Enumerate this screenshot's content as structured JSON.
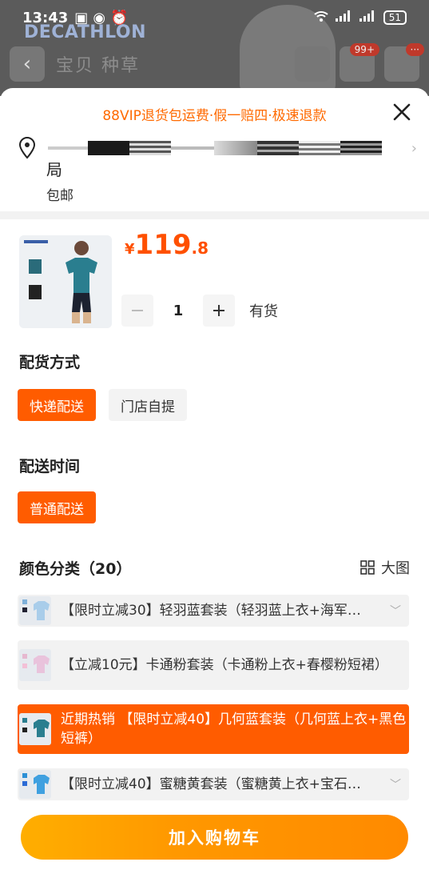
{
  "status_bar": {
    "time": "13:43",
    "battery": "51"
  },
  "background_page": {
    "brand": "DECATHLON",
    "tabs": "宝贝  种草",
    "cart_badge": "99+",
    "more_badge": "···"
  },
  "sheet": {
    "banner": "88VIP退货包运费·假一赔四·极速退款",
    "address_line2": "局",
    "shipping": "包邮",
    "price": {
      "currency": "¥",
      "integer": "119",
      "decimal": ".8"
    },
    "quantity": {
      "value": "1",
      "stock": "有货"
    },
    "delivery_method": {
      "title": "配货方式",
      "options": [
        {
          "label": "快递配送",
          "selected": true
        },
        {
          "label": "门店自提",
          "selected": false
        }
      ]
    },
    "delivery_time": {
      "title": "配送时间",
      "options": [
        {
          "label": "普通配送",
          "selected": true
        }
      ]
    },
    "colors": {
      "title": "颜色分类（20）",
      "big_image_label": "大图",
      "items": [
        {
          "label": "【限时立减30】轻羽蓝套装（轻羽蓝上衣+海军…",
          "selected": false
        },
        {
          "label": "【立减10元】卡通粉套装（卡通粉上衣+春樱粉短裙）",
          "selected": false
        },
        {
          "label": "近期热销 【限时立减40】几何蓝套装（几何蓝上衣+黑色短裤）",
          "selected": true
        },
        {
          "label": "【限时立减40】蜜糖黄套装（蜜糖黄上衣+宝石…",
          "selected": false
        }
      ]
    },
    "add_to_cart": "加入购物车"
  },
  "colors": {
    "accent": "#ff5c00",
    "banner": "#ff6a00",
    "price": "#ff5000"
  }
}
